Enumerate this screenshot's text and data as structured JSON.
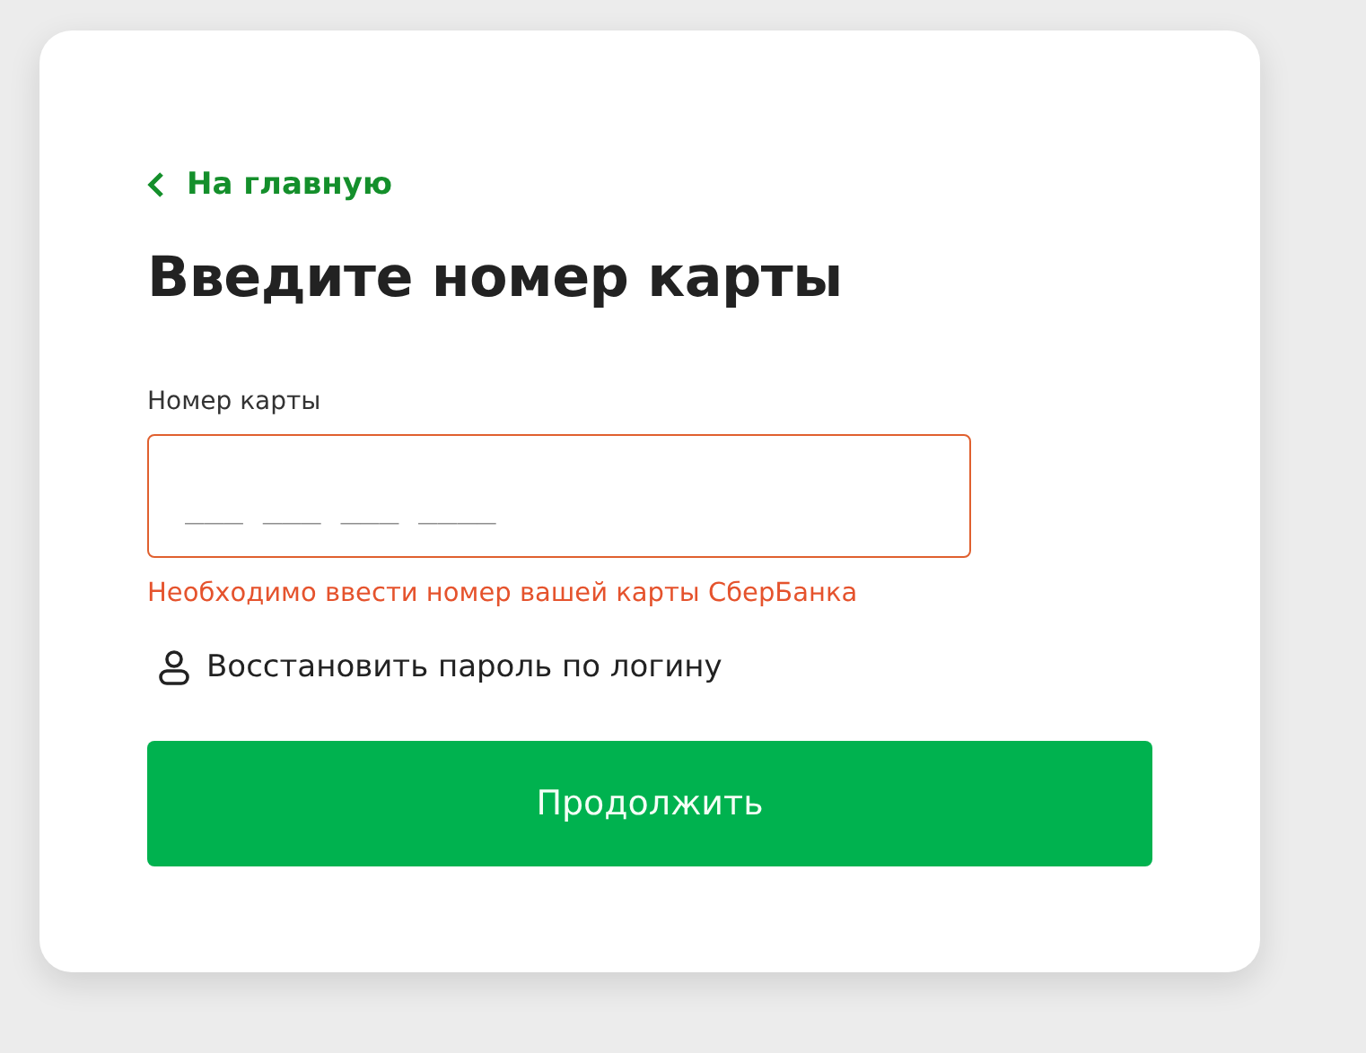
{
  "back_link": {
    "label": "На главную"
  },
  "title": "Введите номер карты",
  "card_field": {
    "label": "Номер карты",
    "placeholder": "___ ___ ___ ____",
    "error": true,
    "error_text": "Необходимо ввести номер вашей карты СберБанка"
  },
  "recover_link": {
    "label": "Восстановить пароль по логину"
  },
  "continue_button": {
    "label": "Продолжить"
  }
}
